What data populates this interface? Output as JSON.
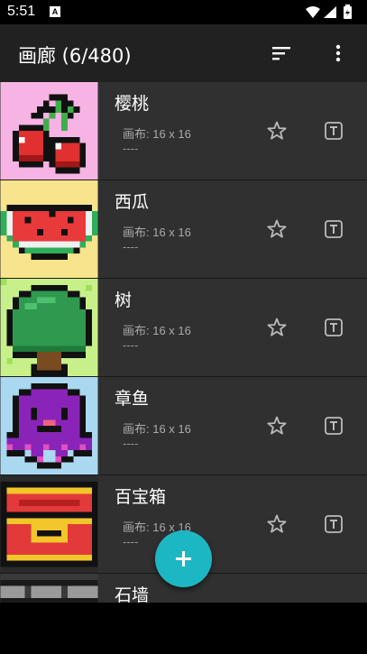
{
  "status": {
    "time": "5:51",
    "notif_badge": "A"
  },
  "app_bar": {
    "title": "画廊 (6/480)",
    "sort_icon": "sort-icon",
    "more_icon": "more-vert-icon"
  },
  "gallery": {
    "canvas_label": "画布: 16 x 16",
    "items": [
      {
        "name": "樱桃",
        "canvas": "画布: 16 x 16",
        "desc": "----",
        "bg": "#f6b3e3"
      },
      {
        "name": "西瓜",
        "canvas": "画布: 16 x 16",
        "desc": "----",
        "bg": "#f7e48c"
      },
      {
        "name": "树",
        "canvas": "画布: 16 x 16",
        "desc": "----",
        "bg": "#c8f08a"
      },
      {
        "name": "章鱼",
        "canvas": "画布: 16 x 16",
        "desc": "----",
        "bg": "#a9d8f0"
      },
      {
        "name": "百宝箱",
        "canvas": "画布: 16 x 16",
        "desc": "----",
        "bg": "#2a2a2a"
      },
      {
        "name": "石墙",
        "canvas": "",
        "desc": "",
        "bg": "#3a3a3a"
      }
    ]
  },
  "fab": {
    "icon": "add-icon",
    "color": "#1db7c4"
  }
}
